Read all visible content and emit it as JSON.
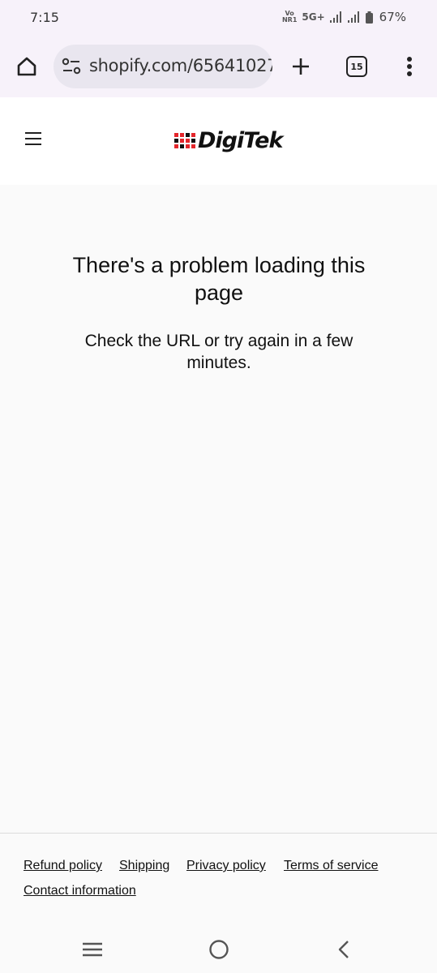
{
  "status_bar": {
    "time": "7:15",
    "volte_top": "Vo",
    "volte_bottom": "NR1",
    "network": "5G+",
    "battery": "67%"
  },
  "browser": {
    "url": "shopify.com/65641027",
    "tab_count": "15"
  },
  "header": {
    "logo_text": "DigiTek"
  },
  "error": {
    "title": "There's a problem loading this page",
    "message": "Check the URL or try again in a few minutes."
  },
  "footer": {
    "links": [
      "Refund policy",
      "Shipping",
      "Privacy policy",
      "Terms of service",
      "Contact information"
    ]
  },
  "colors": {
    "brand_red": "#e4262b",
    "chrome_bg": "#f7f2fa",
    "omnibox_bg": "#e9e6ef"
  }
}
